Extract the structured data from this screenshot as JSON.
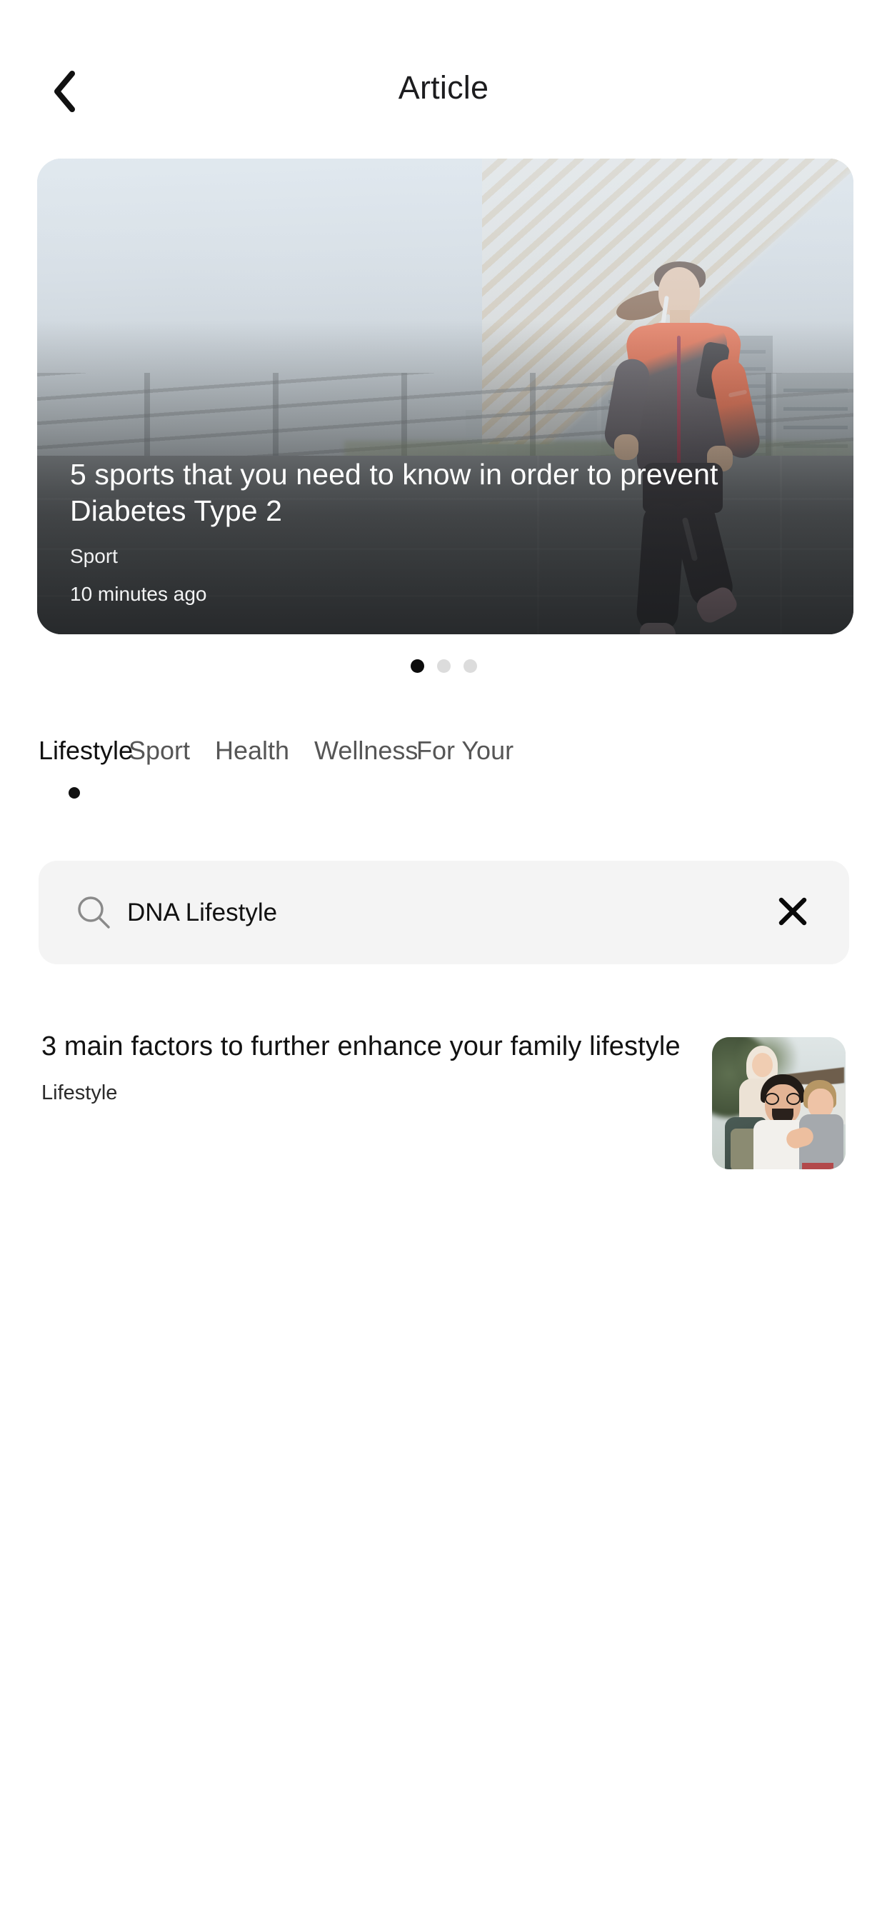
{
  "header": {
    "title": "Article",
    "back_icon": "chevron-left-icon"
  },
  "hero": {
    "title": "5 sports that you need to know in order to prevent Diabetes Type 2",
    "category": "Sport",
    "time": "10 minutes ago",
    "image_description": "woman-running-on-bridge"
  },
  "carousel": {
    "dots": [
      {
        "active": true
      },
      {
        "active": false
      },
      {
        "active": false
      }
    ],
    "active_index": 0,
    "count": 3
  },
  "tabs": {
    "active_index": 0,
    "items": [
      {
        "label": "Lifestyle",
        "active": true
      },
      {
        "label": "Sport",
        "active": false
      },
      {
        "label": "Health",
        "active": false
      },
      {
        "label": "Wellness",
        "active": false
      },
      {
        "label": "For Your",
        "active": false
      }
    ]
  },
  "search": {
    "value": "DNA Lifestyle",
    "placeholder": "Search",
    "search_icon": "search-icon",
    "clear_icon": "close-icon"
  },
  "results": [
    {
      "title": "3 main factors to further enhance your family lifestyle",
      "category": "Lifestyle",
      "thumbnail_description": "father-with-two-children"
    }
  ],
  "colors": {
    "background": "#ffffff",
    "text_primary": "#111111",
    "text_secondary": "#565656",
    "search_background": "#f4f4f4",
    "dot_active": "#0c0c0c",
    "dot_inactive": "#dcdcdc",
    "accent_runner": "#f4663f"
  }
}
